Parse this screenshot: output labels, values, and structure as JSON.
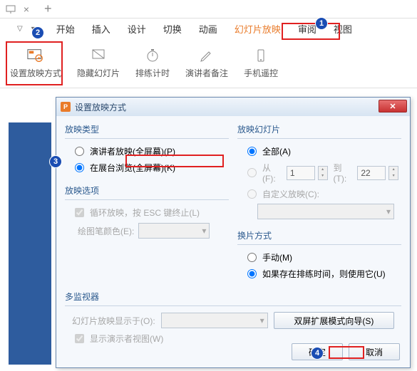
{
  "topbar": {
    "close_x": "×",
    "plus": "+"
  },
  "ribbon": {
    "tabs": [
      "开始",
      "插入",
      "设计",
      "切换",
      "动画",
      "幻灯片放映",
      "审阅",
      "视图"
    ],
    "buttons": {
      "setup": "设置放映方式",
      "hide": "隐藏幻灯片",
      "rehearse": "排练计时",
      "notes": "演讲者备注",
      "remote": "手机遥控"
    }
  },
  "dialog": {
    "title": "设置放映方式",
    "groups": {
      "type": {
        "title": "放映类型",
        "opt_presenter": "演讲者放映(全屏幕)(P)",
        "opt_kiosk": "在展台浏览(全屏幕)(K)"
      },
      "slides": {
        "title": "放映幻灯片",
        "opt_all": "全部(A)",
        "opt_from_lbl": "从(F):",
        "opt_from_val": "1",
        "opt_to_lbl": "到(T):",
        "opt_to_val": "22",
        "opt_custom": "自定义放映(C):"
      },
      "options": {
        "title": "放映选项",
        "loop": "循环放映，按 ESC 键终止(L)",
        "pen": "绘图笔颜色(E):"
      },
      "advance": {
        "title": "换片方式",
        "manual": "手动(M)",
        "timings": "如果存在排练时间，则使用它(U)"
      },
      "monitors": {
        "title": "多监视器",
        "display_on": "幻灯片放映显示于(O):",
        "dual_btn": "双屏扩展模式向导(S)",
        "presenter_view": "显示演示者视图(W)"
      }
    },
    "ok": "确定",
    "cancel": "取消"
  },
  "badges": {
    "b1": "1",
    "b2": "2",
    "b3": "3",
    "b4": "4"
  }
}
